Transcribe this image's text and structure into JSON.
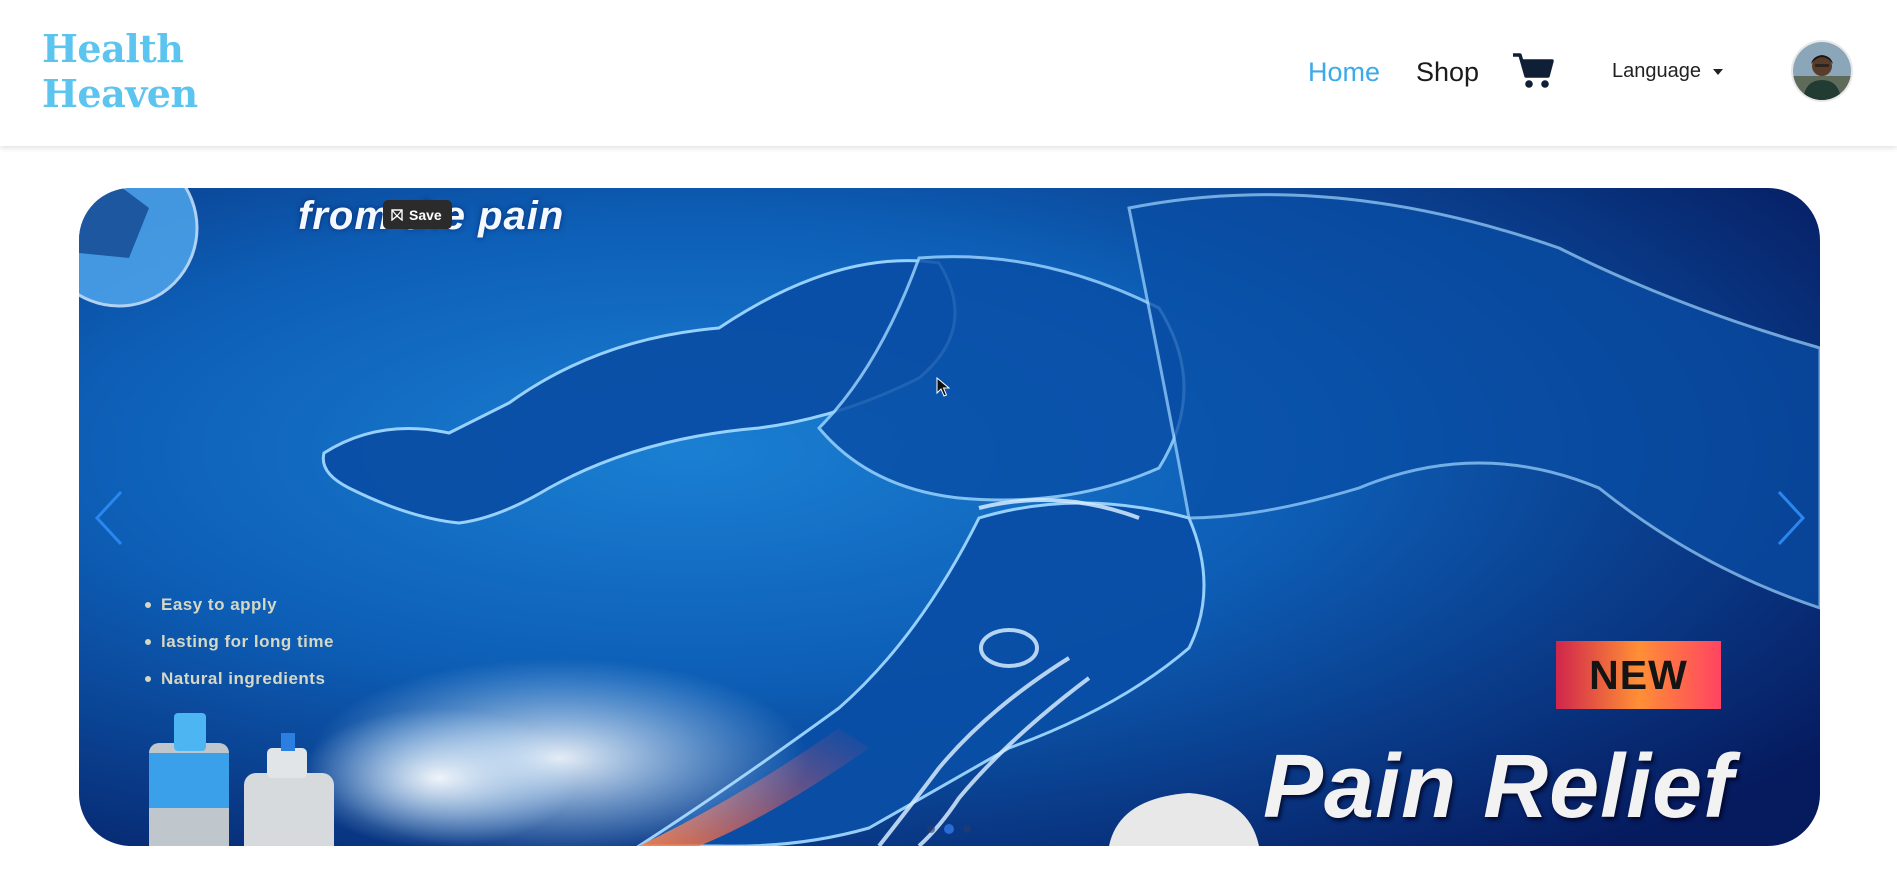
{
  "brand": {
    "line1": "Health",
    "line2": "Heaven"
  },
  "nav": {
    "home": "Home",
    "shop": "Shop",
    "language": "Language"
  },
  "icons": {
    "cart": "cart-icon",
    "avatar": "user-avatar",
    "prev": "chevron-left-icon",
    "next": "chevron-right-icon"
  },
  "colors": {
    "brand": "#5bc4ef",
    "active_nav": "#3ca9e8",
    "hero_blue": "#0b4fa5"
  },
  "hero": {
    "save_label": "Save",
    "slogan": "from the pain",
    "bullets": [
      "Easy to apply",
      "lasting for long time",
      "Natural ingredients"
    ],
    "badge": "NEW",
    "headline": "Pain Relief",
    "active_slide": 2,
    "slide_count": 3
  }
}
